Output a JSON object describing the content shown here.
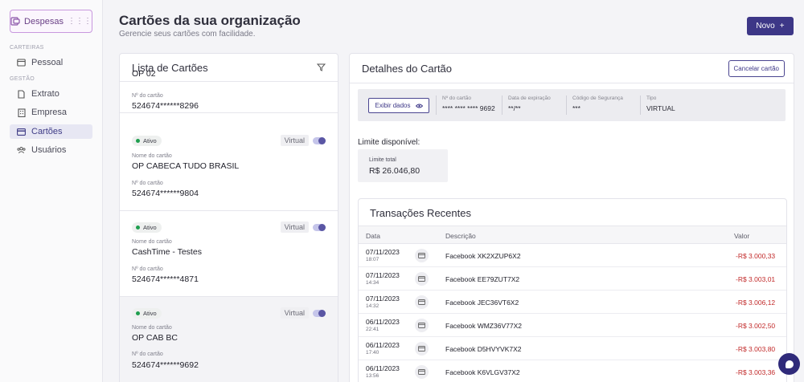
{
  "sidebar": {
    "brand_label": "Despesas",
    "section_carteiras": "CARTEIRAS",
    "section_gestao": "GESTÃO",
    "items": [
      {
        "label": "Pessoal",
        "icon": "wallet-icon"
      },
      {
        "label": "Extrato",
        "icon": "document-icon"
      },
      {
        "label": "Empresa",
        "icon": "building-icon"
      },
      {
        "label": "Cartões",
        "icon": "card-icon",
        "active": true
      },
      {
        "label": "Usuários",
        "icon": "users-icon"
      }
    ]
  },
  "header": {
    "title": "Cartões da sua organização",
    "subtitle": "Gerencie seus cartões com facilidade.",
    "new_label": "Novo",
    "new_icon": "+"
  },
  "card_list": {
    "title": "Lista de Cartões",
    "filter_icon": "filter-icon",
    "partial_name": "OP 02",
    "partial_number_label": "Nº do cartão",
    "partial_number": "524674******8296",
    "cards": [
      {
        "status": "Ativo",
        "type": "Virtual",
        "name_label": "Nome do cartão",
        "name": "OP CABECA TUDO BRASIL",
        "number_label": "Nº do cartão",
        "number": "524674******9804"
      },
      {
        "status": "Ativo",
        "type": "Virtual",
        "name_label": "Nome do cartão",
        "name": "CashTime - Testes",
        "number_label": "Nº do cartão",
        "number": "524674******4871"
      },
      {
        "status": "Ativo",
        "type": "Virtual",
        "name_label": "Nome do cartão",
        "name": "OP CAB BC",
        "number_label": "Nº do cartão",
        "number": "524674******9692",
        "selected": true
      }
    ]
  },
  "details": {
    "title": "Detalhes do Cartão",
    "cancel_label": "Cancelar cartão",
    "show_label": "Exibir dados",
    "card_number_label": "Nº do cartão",
    "card_number": "**** **** **** 9692",
    "expiry_label": "Data de expiração",
    "expiry": "**/**",
    "cvv_label": "Código de Segurança",
    "cvv": "***",
    "type_label": "Tipo",
    "type": "VIRTUAL",
    "limit_title": "Limite disponível:",
    "limit_total_label": "Limite total",
    "limit_total": "R$ 26.046,80"
  },
  "transactions": {
    "title": "Transações Recentes",
    "columns": {
      "date": "Data",
      "description": "Descrição",
      "value": "Valor"
    },
    "rows": [
      {
        "date": "07/11/2023",
        "time": "18:07",
        "description": "Facebook XK2XZUP6X2",
        "value": "-R$ 3.000,33"
      },
      {
        "date": "07/11/2023",
        "time": "14:34",
        "description": "Facebook EE79ZUT7X2",
        "value": "-R$ 3.003,01"
      },
      {
        "date": "07/11/2023",
        "time": "14:32",
        "description": "Facebook JEC36VT6X2",
        "value": "-R$ 3.006,12"
      },
      {
        "date": "06/11/2023",
        "time": "22:41",
        "description": "Facebook WMZ36V77X2",
        "value": "-R$ 3.002,50"
      },
      {
        "date": "06/11/2023",
        "time": "17:40",
        "description": "Facebook D5HVYVK7X2",
        "value": "-R$ 3.003,80"
      },
      {
        "date": "06/11/2023",
        "time": "13:56",
        "description": "Facebook K6VLGV37X2",
        "value": "-R$ 3.003,36"
      }
    ]
  },
  "colors": {
    "primary": "#3d3787",
    "negative": "#c22a2a",
    "active": "#1e9e4e"
  }
}
